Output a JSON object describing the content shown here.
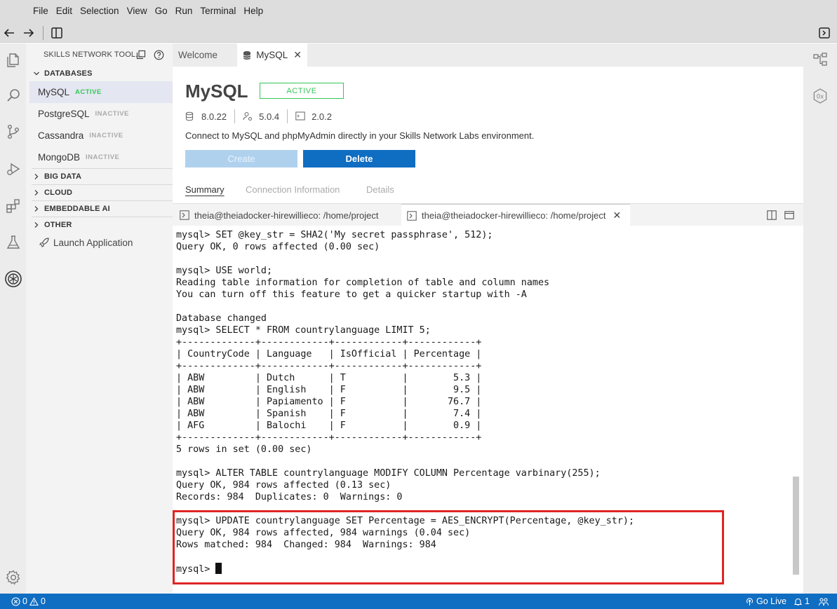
{
  "menu": [
    "File",
    "Edit",
    "Selection",
    "View",
    "Go",
    "Run",
    "Terminal",
    "Help"
  ],
  "sidebar": {
    "title": "SKILLS NETWORK TOOL...",
    "sections": {
      "databases": "DATABASES",
      "big_data": "BIG DATA",
      "cloud": "CLOUD",
      "embeddable_ai": "EMBEDDABLE AI",
      "other": "OTHER"
    },
    "databases": [
      {
        "name": "MySQL",
        "status": "ACTIVE"
      },
      {
        "name": "PostgreSQL",
        "status": "INACTIVE"
      },
      {
        "name": "Cassandra",
        "status": "INACTIVE"
      },
      {
        "name": "MongoDB",
        "status": "INACTIVE"
      }
    ],
    "launch_application": "Launch Application"
  },
  "editor_tabs": [
    {
      "label": "Welcome"
    },
    {
      "label": "MySQL"
    }
  ],
  "panel": {
    "title": "MySQL",
    "status_badge": "ACTIVE",
    "versions": [
      "8.0.22",
      "5.0.4",
      "2.0.2"
    ],
    "description": "Connect to MySQL and phpMyAdmin directly in your Skills Network Labs environment.",
    "create_label": "Create",
    "delete_label": "Delete",
    "subtabs": [
      "Summary",
      "Connection Information",
      "Details"
    ]
  },
  "terminal_tabs": [
    {
      "label": "theia@theiadocker-hirewillieco: /home/project"
    },
    {
      "label": "theia@theiadocker-hirewillieco: /home/project"
    }
  ],
  "terminal": {
    "lines": [
      "mysql> SET @key_str = SHA2('My secret passphrase', 512);",
      "Query OK, 0 rows affected (0.00 sec)",
      "",
      "mysql> USE world;",
      "Reading table information for completion of table and column names",
      "You can turn off this feature to get a quicker startup with -A",
      "",
      "Database changed",
      "mysql> SELECT * FROM countrylanguage LIMIT 5;",
      "+-------------+------------+------------+------------+",
      "| CountryCode | Language   | IsOfficial | Percentage |",
      "+-------------+------------+------------+------------+",
      "| ABW         | Dutch      | T          |        5.3 |",
      "| ABW         | English    | F          |        9.5 |",
      "| ABW         | Papiamento | F          |       76.7 |",
      "| ABW         | Spanish    | F          |        7.4 |",
      "| AFG         | Balochi    | F          |        0.9 |",
      "+-------------+------------+------------+------------+",
      "5 rows in set (0.00 sec)",
      "",
      "mysql> ALTER TABLE countrylanguage MODIFY COLUMN Percentage varbinary(255);",
      "Query OK, 984 rows affected (0.13 sec)",
      "Records: 984  Duplicates: 0  Warnings: 0",
      "",
      "mysql> UPDATE countrylanguage SET Percentage = AES_ENCRYPT(Percentage, @key_str);",
      "Query OK, 984 rows affected, 984 warnings (0.04 sec)",
      "Rows matched: 984  Changed: 984  Warnings: 984",
      ""
    ],
    "prompt": "mysql> "
  },
  "statusbar": {
    "errors": "0",
    "warnings": "0",
    "go_live": "Go Live",
    "notifications": "1"
  },
  "colors": {
    "accent": "#0f6dc2",
    "active_status": "#34c759",
    "highlight": "#e02424"
  }
}
